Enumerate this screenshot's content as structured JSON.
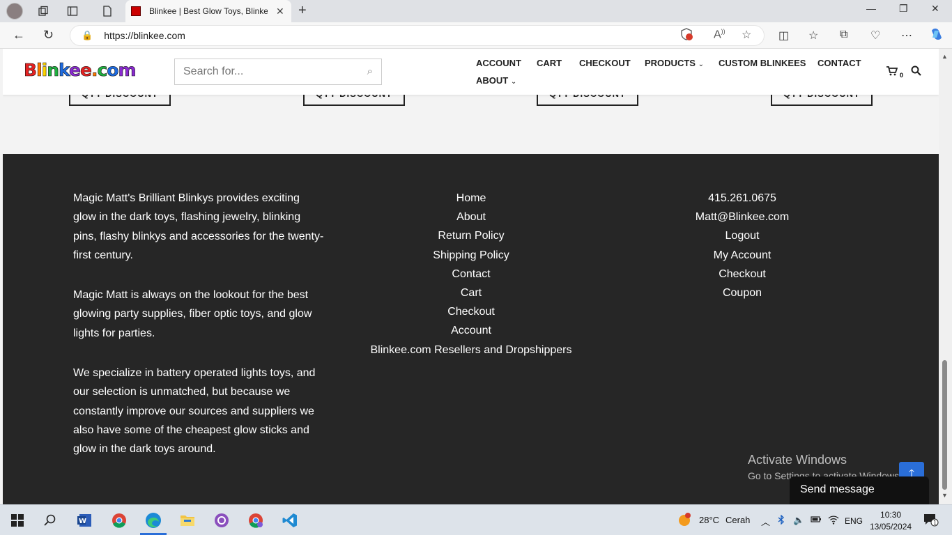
{
  "browser": {
    "tab_title": "Blinkee | Best Glow Toys, Blinkee",
    "url": "https://blinkee.com",
    "url_host": "blinkee.com",
    "extension_badge": "1"
  },
  "site": {
    "logo_text": "Blinkee.com",
    "search_placeholder": "Search for...",
    "menu": {
      "account": "ACCOUNT",
      "cart": "CART",
      "checkout": "CHECKOUT",
      "products": "PRODUCTS",
      "custom": "CUSTOM BLINKEES",
      "contact": "CONTACT",
      "about": "ABOUT"
    },
    "cart_count": "0",
    "qty_button": "QTY DISCOUNT"
  },
  "footer": {
    "about_paragraphs": [
      "Magic Matt's Brilliant Blinkys provides exciting glow in the dark toys, flashing jewelry, blinking pins, flashy blinkys and accessories for the twenty-first century.",
      "Magic Matt is always on the lookout for the best glowing party supplies, fiber optic toys, and glow lights for parties.",
      "We specialize in battery operated lights toys, and our selection is unmatched, but because we constantly improve our sources and suppliers we also have some of the cheapest glow sticks and glow in the dark toys around."
    ],
    "links_col2": [
      "Home",
      "About",
      "Return Policy",
      "Shipping Policy",
      "Contact",
      "Cart",
      "Checkout",
      "Account",
      "Blinkee.com Resellers and Dropshippers"
    ],
    "links_col3": [
      "415.261.0675",
      "Matt@Blinkee.com",
      "Logout",
      "My Account",
      "Checkout",
      "Coupon"
    ]
  },
  "overlay": {
    "activate_title": "Activate Windows",
    "activate_sub": "Go to Settings to activate Windows.",
    "send_message": "Send message"
  },
  "taskbar": {
    "weather_temp": "28°C",
    "weather_text": "Cerah",
    "weather_badge": "1",
    "lang": "ENG",
    "time": "10:30",
    "date": "13/05/2024",
    "notif_count": "1"
  }
}
